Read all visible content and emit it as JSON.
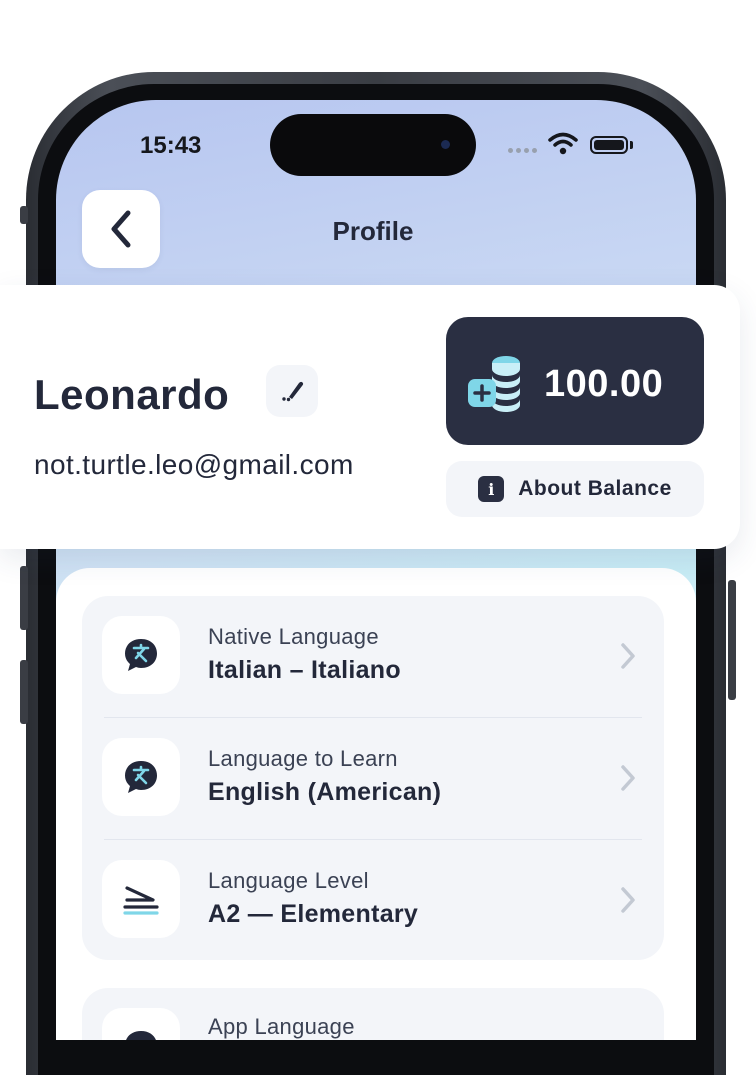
{
  "status_bar": {
    "time": "15:43"
  },
  "header": {
    "title": "Profile",
    "back_icon": "chevron-left-icon"
  },
  "profile": {
    "name": "Leonardo",
    "email": "not.turtle.leo@gmail.com",
    "edit_icon": "pencil-icon"
  },
  "balance": {
    "amount": "100.00",
    "icon": "coins-add-icon",
    "about_label": "About Balance",
    "about_icon": "info-icon"
  },
  "settings": {
    "language_group": [
      {
        "label": "Native Language",
        "value": "Italian – Italiano",
        "icon": "translate-bubble-icon"
      },
      {
        "label": "Language to Learn",
        "value": "English (American)",
        "icon": "translate-bubble-icon"
      },
      {
        "label": "Language Level",
        "value": "A2 — Elementary",
        "icon": "level-icon"
      }
    ],
    "app_group": [
      {
        "label": "App Language",
        "value": "",
        "icon": "translate-bubble-icon"
      }
    ]
  },
  "colors": {
    "accent_dark": "#2a2f42",
    "icon_accent": "#7fd6e8",
    "text_primary": "#23283a"
  }
}
